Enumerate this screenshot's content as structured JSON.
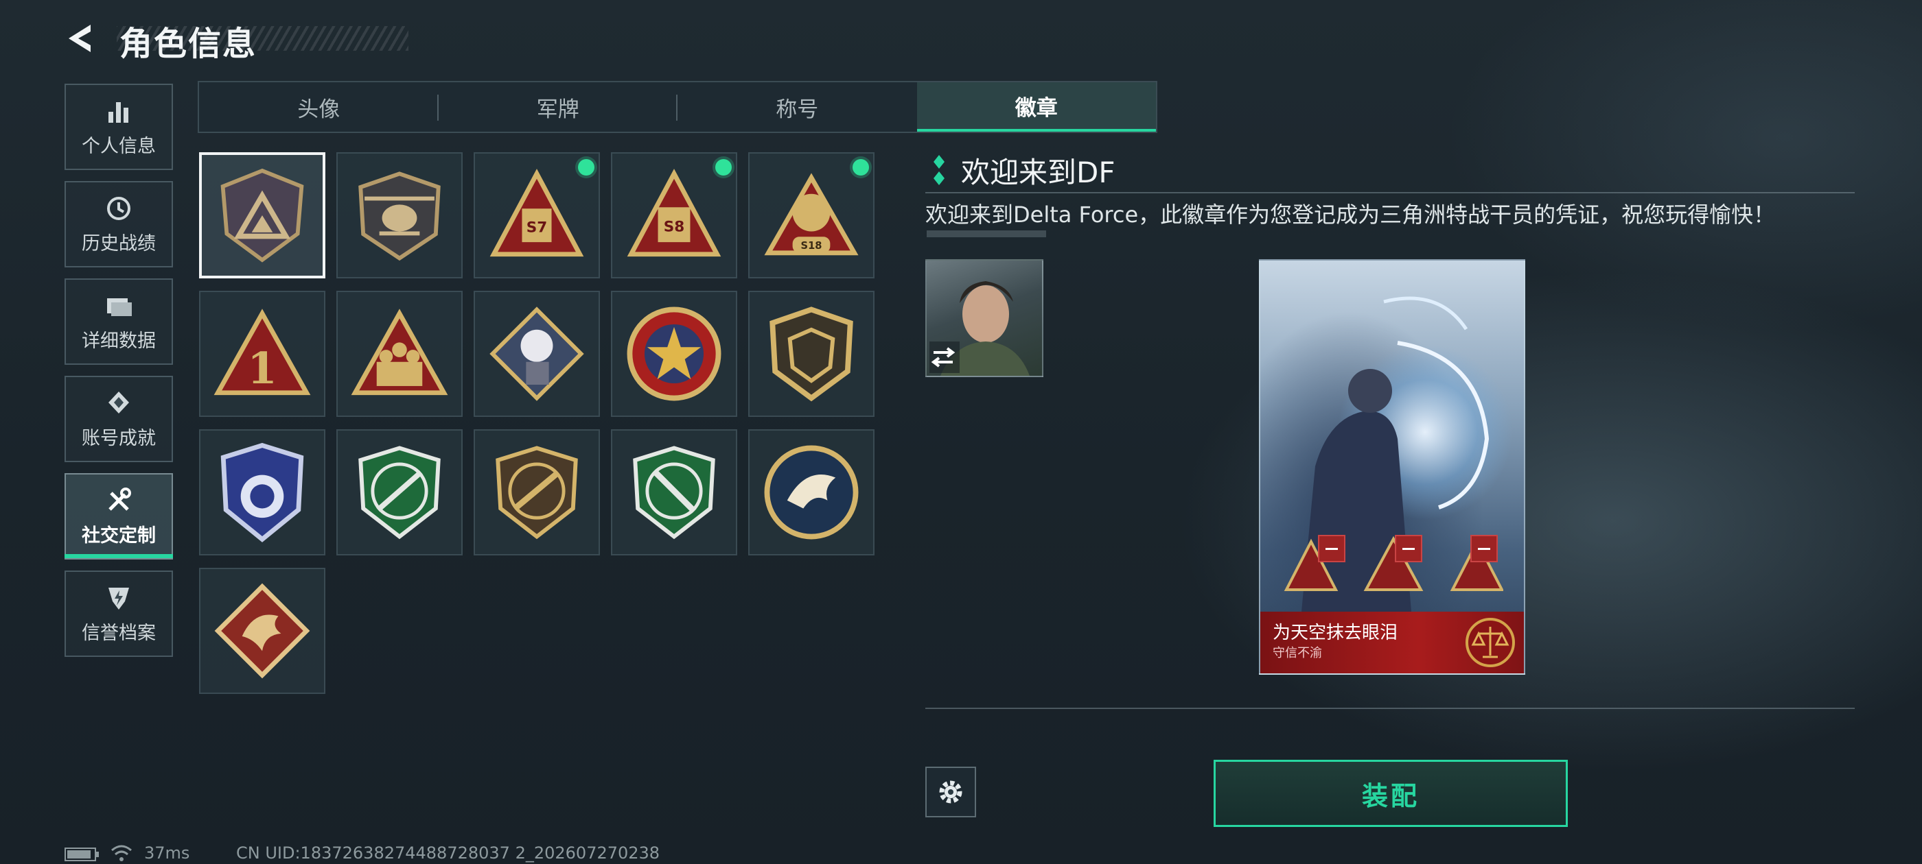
{
  "header": {
    "title": "角色信息"
  },
  "sidebar": {
    "items": [
      {
        "label": "个人信息",
        "icon": "bar-chart-icon"
      },
      {
        "label": "历史战绩",
        "icon": "history-icon"
      },
      {
        "label": "详细数据",
        "icon": "folder-icon"
      },
      {
        "label": "账号成就",
        "icon": "achievement-icon"
      },
      {
        "label": "社交定制",
        "icon": "tools-icon",
        "active": true
      },
      {
        "label": "信誉档案",
        "icon": "shield-lightning-icon"
      }
    ]
  },
  "tabs": [
    {
      "label": "头像"
    },
    {
      "label": "军牌"
    },
    {
      "label": "称号"
    },
    {
      "label": "徽章",
      "active": true
    }
  ],
  "badges": {
    "labels": {
      "s7": "S7",
      "s8": "S8",
      "s18": "S18",
      "one": "1"
    },
    "new_dot_color": "#2fe29a"
  },
  "detail": {
    "title": "欢迎来到DF",
    "description": "欢迎来到Delta Force，此徽章作为您登记成为三角洲特战干员的凭证，祝您玩得愉快！",
    "preview_card": {
      "name": "为天空抹去眼泪",
      "subtitle": "守信不渝"
    },
    "equip_label": "装配"
  },
  "status_bar": {
    "ping": "37ms",
    "uid": "CN UID:18372638274488728037 2_202607270238"
  },
  "colors": {
    "accent": "#27d6a0",
    "card_red": "#a81c1c"
  }
}
